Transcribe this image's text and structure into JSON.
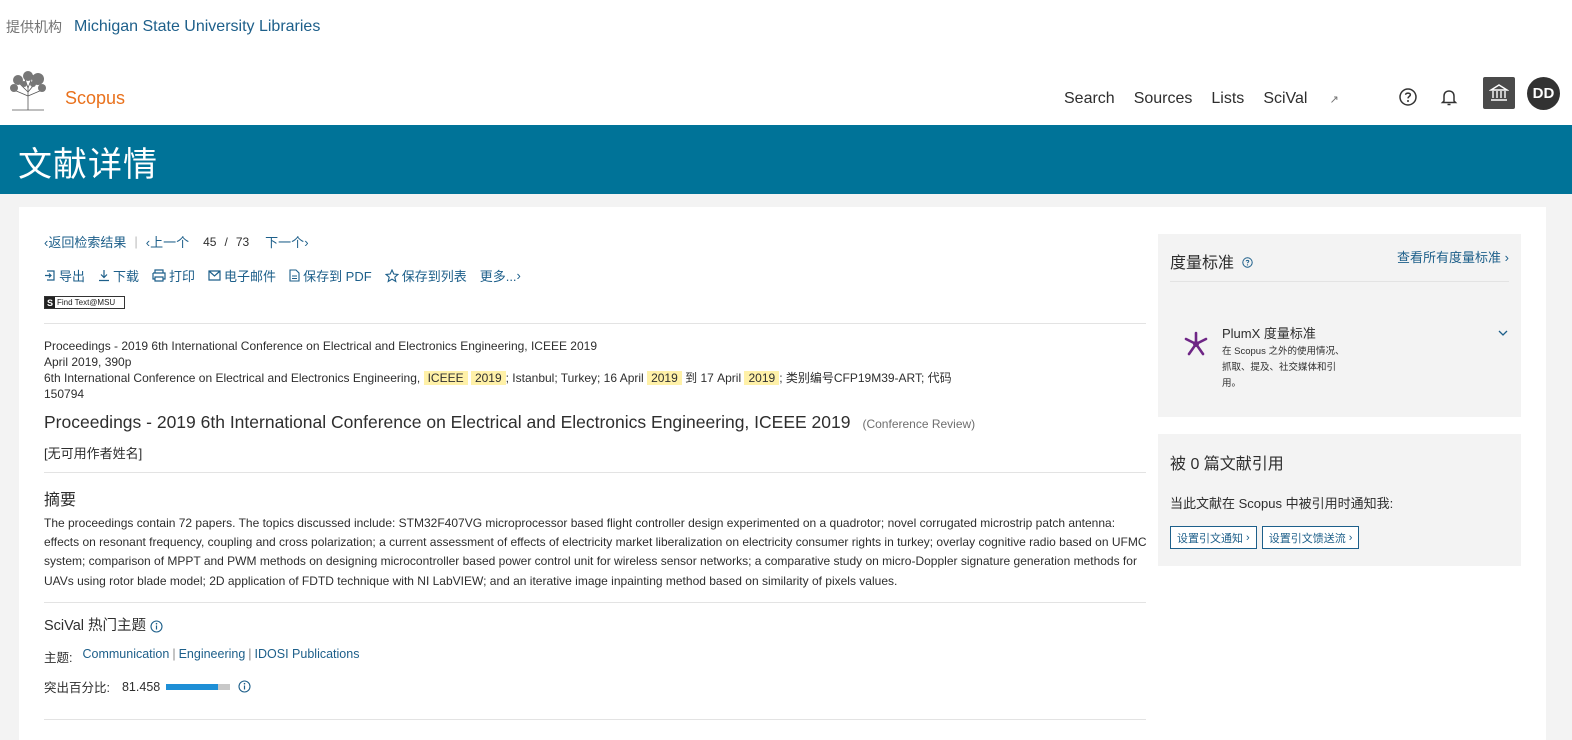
{
  "institution": {
    "label": "提供机构",
    "name": "Michigan State University Libraries"
  },
  "header": {
    "brand": "Scopus",
    "nav": [
      "Search",
      "Sources",
      "Lists",
      "SciVal"
    ],
    "scival_ext_glyph": "↗",
    "avatar_initials": "DD",
    "icons": [
      "help-icon",
      "bell-icon",
      "institution-icon"
    ]
  },
  "banner": {
    "title": "文献详情"
  },
  "result_nav": {
    "back": "返回检索结果",
    "prev": "上一个",
    "current": "45",
    "slash": "/",
    "total": "73",
    "next": "下一个"
  },
  "actions": {
    "export": "导出",
    "download": "下载",
    "print": "打印",
    "email": "电子邮件",
    "save_pdf": "保存到 PDF",
    "save_list": "保存到列表",
    "more": "更多..."
  },
  "find_text": {
    "s": "S",
    "label": "Find Text@MSU"
  },
  "source": {
    "line1": "Proceedings - 2019 6th International Conference on Electrical and Electronics Engineering, ICEEE 2019",
    "line2": "April 2019, 390p",
    "line3_a": "6th International Conference on Electrical and Electronics Engineering,",
    "hl1": "ICEEE",
    "hl2": "2019",
    "line3_b": "; Istanbul; Turkey; 16 April",
    "hl3": "2019",
    "line3_c": "到 17 April",
    "hl4": "2019",
    "line3_d": "; 类别编号CFP19M39-ART; 代码 150794"
  },
  "document": {
    "title": "Proceedings - 2019 6th International Conference on Electrical and Electronics Engineering, ICEEE 2019",
    "type": "(Conference Review)",
    "authors": "[无可用作者姓名]"
  },
  "abstract": {
    "heading": "摘要",
    "text": "The proceedings contain 72 papers. The topics discussed include: STM32F407VG microprocessor based flight controller design experimented on a quadrotor; novel corrugated microstrip patch antenna: effects on resonant frequency, coupling and cross polarization; a current assessment of effects of electricity market liberalization on electricity consumer rights in turkey; overlay cognitive radio based on UFMC system; comparison of MPPT and PWM methods on designing microcontroller based power control unit for wireless sensor networks; a comparative study on micro-Doppler signature generation methods for UAVs using rotor blade model; 2D application of FDTD technique with NI LabVIEW; and an iterative image inpainting method based on similarity of pixels values."
  },
  "scival_topics": {
    "heading": "SciVal 热门主题",
    "topic_label": "主题:",
    "topics": [
      "Communication",
      "Engineering",
      "IDOSI Publications"
    ],
    "separator": "|",
    "prominence_label": "突出百分比:",
    "prominence_value": "81.458",
    "prominence_fraction": 0.81458
  },
  "metrics_panel": {
    "heading": "度量标准",
    "view_all": "查看所有度量标准",
    "plumx_title": "PlumX 度量标准",
    "plumx_desc": "在 Scopus 之外的使用情况、抓取、提及、社交媒体和引用。"
  },
  "cited_panel": {
    "heading": "被 0 篇文献引用",
    "desc": "当此文献在 Scopus 中被引用时通知我:",
    "btn_alert": "设置引文通知",
    "btn_feed": "设置引文馈送流"
  },
  "colors": {
    "banner": "#007398",
    "link": "#1d5f8a",
    "brand": "#e9711c",
    "highlight": "#fff1a8",
    "bar_fill": "#1e8fd6"
  }
}
